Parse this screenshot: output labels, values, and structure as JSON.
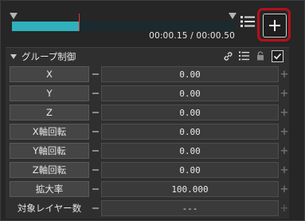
{
  "timeline": {
    "timecode": "00:00.15 / 00:00.50",
    "progress": 0.3,
    "playhead": 0.3
  },
  "toolbar": {
    "add_button": "+"
  },
  "panel": {
    "title": "グループ制御",
    "checked": true,
    "rows": [
      {
        "label": "X",
        "value": "0.00"
      },
      {
        "label": "Y",
        "value": "0.00"
      },
      {
        "label": "Z",
        "value": "0.00"
      },
      {
        "label": "X軸回転",
        "value": "0.00"
      },
      {
        "label": "Y軸回転",
        "value": "0.00"
      },
      {
        "label": "Z軸回転",
        "value": "0.00"
      },
      {
        "label": "拡大率",
        "value": "100.000"
      },
      {
        "label": "対象レイヤー数",
        "value": "---"
      }
    ]
  },
  "colors": {
    "track_fill": "#2fb0bd",
    "playhead": "#d23a3a",
    "highlight": "#b3111b"
  }
}
